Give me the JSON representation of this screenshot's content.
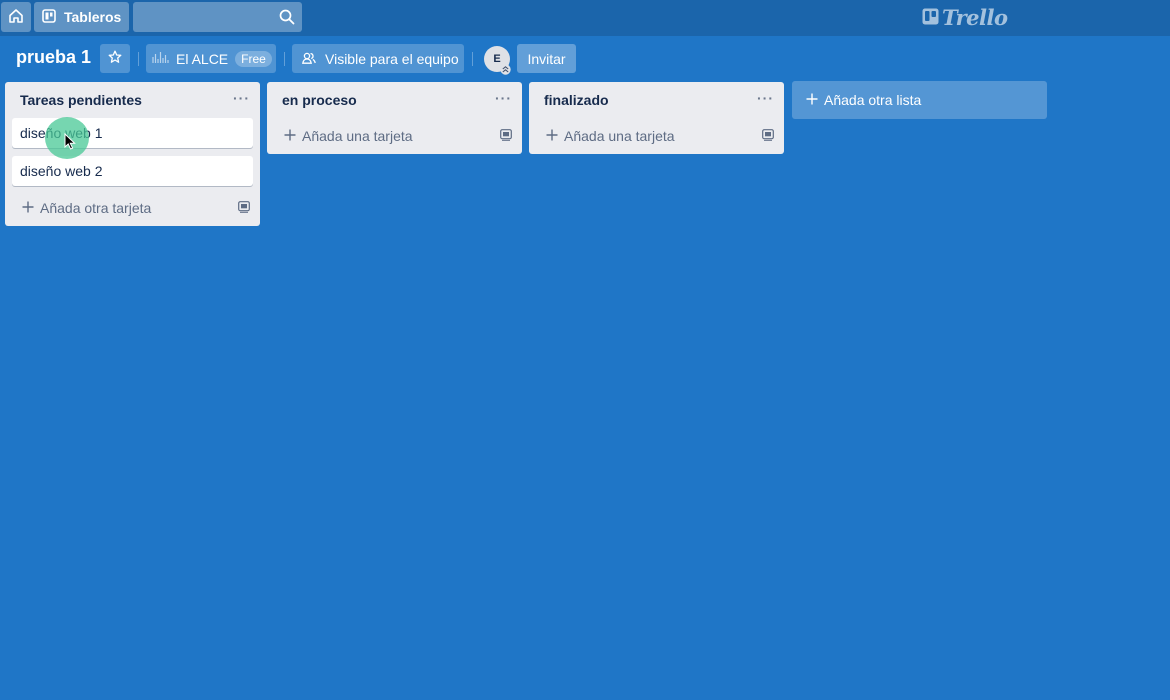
{
  "topbar": {
    "boards_label": "Tableros",
    "search_placeholder": "",
    "logo_text": "Trello"
  },
  "board": {
    "title": "prueba 1",
    "team_name": "El ALCE",
    "team_badge": "Free",
    "visibility_label": "Visible para el equipo",
    "avatar_initial": "E",
    "invite_label": "Invitar"
  },
  "lists": [
    {
      "title": "Tareas pendientes",
      "menu": "···",
      "cards": [
        "diseño web 1",
        "diseño web 2"
      ],
      "add_label": "Añada otra tarjeta"
    },
    {
      "title": "en proceso",
      "menu": "···",
      "cards": [],
      "add_label": "Añada una tarjeta"
    },
    {
      "title": "finalizado",
      "menu": "···",
      "cards": [],
      "add_label": "Añada una tarjeta"
    }
  ],
  "add_list_label": "Añada otra lista",
  "colors": {
    "board_background": "#1f76c7",
    "topbar": "#1b65ab",
    "list_background": "#ebecf0",
    "click_indicator": "#48c896"
  }
}
